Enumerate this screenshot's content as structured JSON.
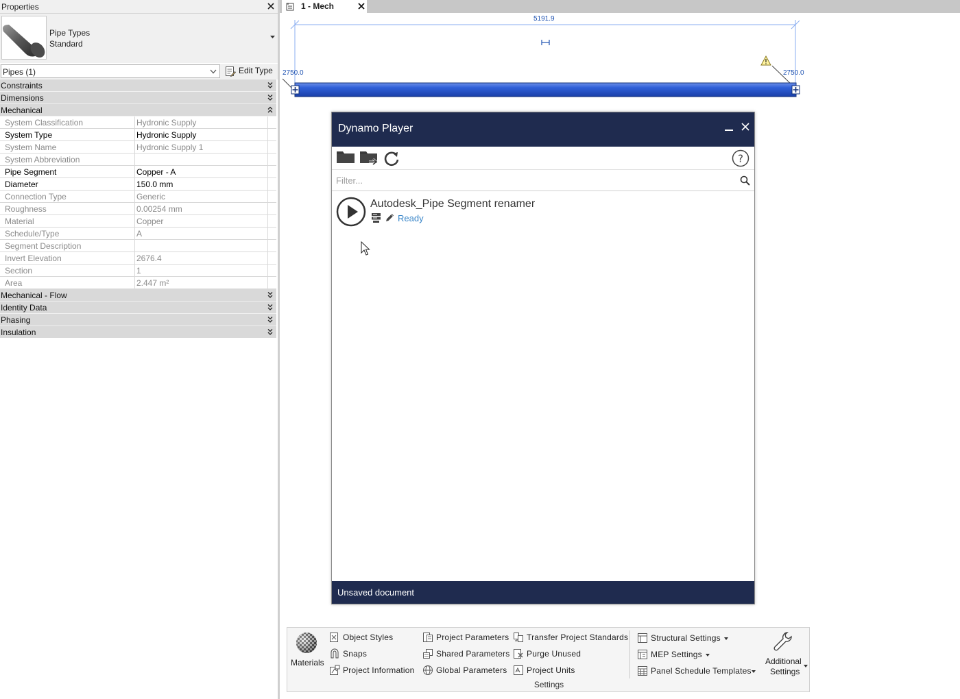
{
  "properties": {
    "title": "Properties",
    "type_selector": {
      "family": "Pipe Types",
      "type": "Standard"
    },
    "instance_filter": "Pipes (1)",
    "edit_type_label": "Edit Type",
    "groups": [
      {
        "name": "Constraints",
        "expanded": false
      },
      {
        "name": "Dimensions",
        "expanded": false
      },
      {
        "name": "Mechanical",
        "expanded": true
      },
      {
        "name": "Mechanical - Flow",
        "expanded": false
      },
      {
        "name": "Identity Data",
        "expanded": false
      },
      {
        "name": "Phasing",
        "expanded": false
      },
      {
        "name": "Insulation",
        "expanded": false
      }
    ],
    "mechanical_params": [
      {
        "name": "System Classification",
        "value": "Hydronic Supply",
        "editable": false
      },
      {
        "name": "System Type",
        "value": "Hydronic Supply",
        "editable": true
      },
      {
        "name": "System Name",
        "value": "Hydronic Supply 1",
        "editable": false
      },
      {
        "name": "System Abbreviation",
        "value": "",
        "editable": false
      },
      {
        "name": "Pipe Segment",
        "value": "Copper - A",
        "editable": true
      },
      {
        "name": "Diameter",
        "value": "150.0 mm",
        "editable": true
      },
      {
        "name": "Connection Type",
        "value": "Generic",
        "editable": false
      },
      {
        "name": "Roughness",
        "value": "0.00254 mm",
        "editable": false
      },
      {
        "name": "Material",
        "value": "Copper",
        "editable": false
      },
      {
        "name": "Schedule/Type",
        "value": "A",
        "editable": false
      },
      {
        "name": "Segment Description",
        "value": "",
        "editable": false
      },
      {
        "name": "Invert Elevation",
        "value": "2676.4",
        "editable": false
      },
      {
        "name": "Section",
        "value": "1",
        "editable": false
      },
      {
        "name": "Area",
        "value": "2.447 m²",
        "editable": false
      }
    ]
  },
  "view_tab": {
    "label": "1 - Mech"
  },
  "canvas": {
    "dimension_length": "5191.9",
    "elevation_left": "2750.0",
    "elevation_right": "2750.0",
    "pipe_color": "#2f5fd8"
  },
  "dynamo_player": {
    "title": "Dynamo Player",
    "filter_placeholder": "Filter...",
    "scripts": [
      {
        "name": "Autodesk_Pipe Segment renamer",
        "status": "Ready"
      }
    ],
    "footer": "Unsaved document",
    "colors": {
      "header": "#1f2b4f",
      "status": "#3a86c8"
    }
  },
  "ribbon": {
    "materials": "Materials",
    "col1": [
      "Object Styles",
      "Snaps",
      "Project Information"
    ],
    "col2": [
      "Project Parameters",
      "Shared Parameters",
      "Global Parameters"
    ],
    "col3": [
      "Transfer Project Standards",
      "Purge Unused",
      "Project Units"
    ],
    "col4": [
      "Structural Settings",
      "MEP Settings",
      "Panel Schedule Templates"
    ],
    "additional_line1": "Additional",
    "additional_line2": "Settings",
    "panel_title": "Settings"
  }
}
